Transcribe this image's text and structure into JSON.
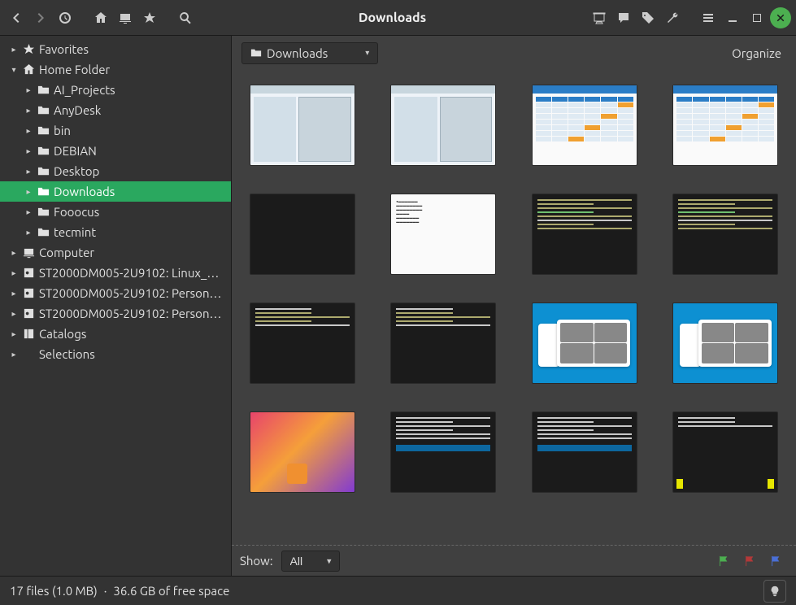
{
  "window_title": "Downloads",
  "breadcrumb": {
    "current": "Downloads"
  },
  "organize_label": "Organize",
  "sidebar": {
    "items": [
      {
        "label": "Favorites",
        "icon": "star",
        "depth": 0,
        "expanded": false
      },
      {
        "label": "Home Folder",
        "icon": "home",
        "depth": 0,
        "expanded": true
      },
      {
        "label": "AI_Projects",
        "icon": "folder",
        "depth": 1,
        "expanded": false
      },
      {
        "label": "AnyDesk",
        "icon": "folder",
        "depth": 1,
        "expanded": false
      },
      {
        "label": "bin",
        "icon": "folder",
        "depth": 1,
        "expanded": false
      },
      {
        "label": "DEBIAN",
        "icon": "folder",
        "depth": 1,
        "expanded": false
      },
      {
        "label": "Desktop",
        "icon": "folder",
        "depth": 1,
        "expanded": false
      },
      {
        "label": "Downloads",
        "icon": "folder",
        "depth": 1,
        "expanded": false,
        "selected": true
      },
      {
        "label": "Fooocus",
        "icon": "folder",
        "depth": 1,
        "expanded": false
      },
      {
        "label": "tecmint",
        "icon": "folder",
        "depth": 1,
        "expanded": false
      },
      {
        "label": "Computer",
        "icon": "computer",
        "depth": 0,
        "expanded": false
      },
      {
        "label": "ST2000DM005-2U9102: Linux_…",
        "icon": "disk",
        "depth": 0,
        "expanded": false
      },
      {
        "label": "ST2000DM005-2U9102: Person…",
        "icon": "disk",
        "depth": 0,
        "expanded": false
      },
      {
        "label": "ST2000DM005-2U9102: Person…",
        "icon": "disk",
        "depth": 0,
        "expanded": false
      },
      {
        "label": "Catalogs",
        "icon": "catalog",
        "depth": 0,
        "expanded": false
      },
      {
        "label": "Selections",
        "icon": "none",
        "depth": 0,
        "expanded": false
      }
    ]
  },
  "files": [
    {
      "kind": "app-light"
    },
    {
      "kind": "app-light"
    },
    {
      "kind": "table"
    },
    {
      "kind": "table"
    },
    {
      "kind": "black"
    },
    {
      "kind": "white-doc"
    },
    {
      "kind": "terminal"
    },
    {
      "kind": "terminal"
    },
    {
      "kind": "terminal-small"
    },
    {
      "kind": "terminal-small"
    },
    {
      "kind": "video-blue"
    },
    {
      "kind": "video-blue"
    },
    {
      "kind": "colorful"
    },
    {
      "kind": "term-tecmint"
    },
    {
      "kind": "term-tecmint"
    },
    {
      "kind": "term-yellow"
    }
  ],
  "showbar": {
    "label": "Show:",
    "selected": "All"
  },
  "flags": [
    "green",
    "red",
    "blue"
  ],
  "status": {
    "file_count": "17 files (1.0 MB)",
    "sep": "·",
    "free_space": "36.6 GB of free space"
  }
}
